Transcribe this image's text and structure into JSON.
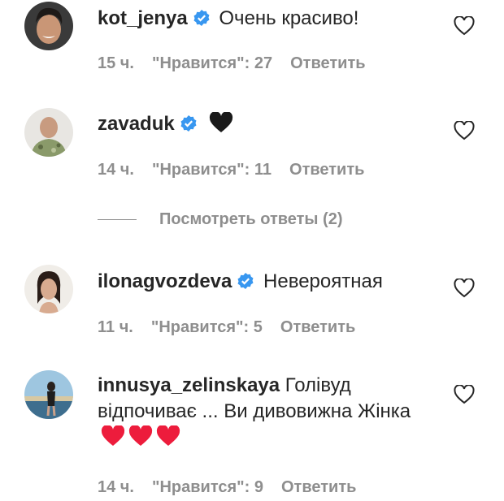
{
  "comments": [
    {
      "username": "kot_jenya",
      "verified": true,
      "text": "Очень красиво!",
      "time": "15 ч.",
      "likes": "\"Нравится\": 27",
      "reply": "Ответить"
    },
    {
      "username": "zavaduk",
      "verified": true,
      "text": "",
      "emoji": "black-heart",
      "time": "14 ч.",
      "likes": "\"Нравится\": 11",
      "reply": "Ответить"
    },
    {
      "username": "ilonagvozdeva",
      "verified": true,
      "text": "Невероятная",
      "time": "11 ч.",
      "likes": "\"Нравится\": 5",
      "reply": "Ответить"
    },
    {
      "username": "innusya_zelinskaya",
      "verified": false,
      "text": "Голівуд відпочиває ... Ви дивовижна Жінка",
      "emoji": "red-heart x3",
      "time": "14 ч.",
      "likes": "\"Нравится\": 9",
      "reply": "Ответить"
    }
  ],
  "view_replies": "Посмотреть ответы (2)",
  "colors": {
    "verified": "#3897f0",
    "meta": "#8e8e8e",
    "heart_red": "#ed1c3c"
  }
}
